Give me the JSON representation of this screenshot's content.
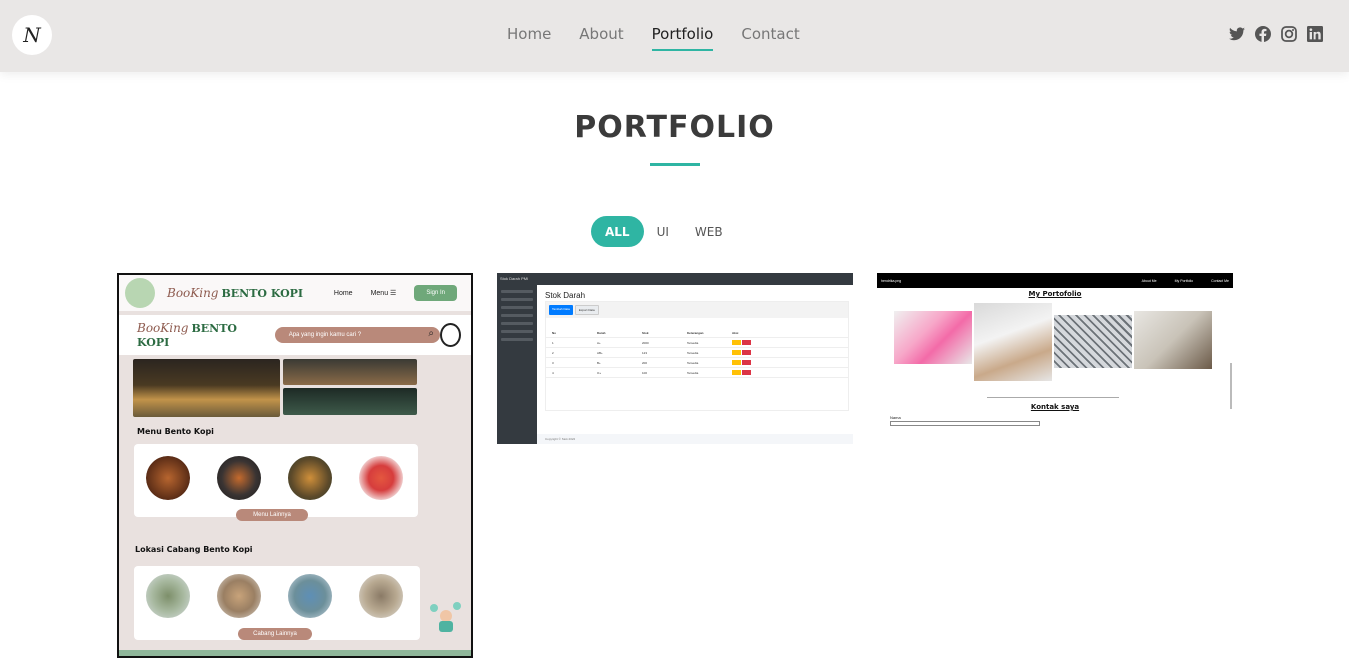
{
  "logo": {
    "text": "N"
  },
  "nav": {
    "items": [
      {
        "label": "Home",
        "active": false
      },
      {
        "label": "About",
        "active": false
      },
      {
        "label": "Portfolio",
        "active": true
      },
      {
        "label": "Contact",
        "active": false
      }
    ]
  },
  "social": [
    "twitter-icon",
    "facebook-icon",
    "instagram-icon",
    "linkedin-icon"
  ],
  "section": {
    "title": "PORTFOLIO"
  },
  "filters": [
    {
      "label": "ALL",
      "active": true
    },
    {
      "label": "UI",
      "active": false
    },
    {
      "label": "WEB",
      "active": false
    }
  ],
  "colors": {
    "accent": "#2fb5a3",
    "header_bg": "#e9e7e6",
    "title": "#3b3b3b"
  },
  "cards": {
    "bento": {
      "brand_script": "BooKing",
      "brand_name": "BENTO KOPI",
      "nav_home": "Home",
      "nav_menu": "Menu ☰",
      "signin": "Sign In",
      "search_placeholder": "Apa yang ingin kamu cari ?",
      "menu_heading": "Menu Bento Kopi",
      "menu_more": "Menu Lainnya",
      "branch_heading": "Lokasi Cabang Bento Kopi",
      "branch_more": "Cabang Lainnya"
    },
    "admin": {
      "app_name": "Stok Darah PMI",
      "page_title": "Stok Darah",
      "btn_add": "Tambah Data",
      "btn_export": "Export Data",
      "columns": [
        "No",
        "Darah",
        "Stok",
        "Keterangan",
        "Aksi"
      ],
      "rows": [
        [
          "1",
          "A+",
          "2000",
          "Tersedia"
        ],
        [
          "2",
          "AB+",
          "123",
          "Tersedia"
        ],
        [
          "3",
          "B+",
          "200",
          "Tersedia"
        ],
        [
          "4",
          "O+",
          "100",
          "Tersedia"
        ]
      ],
      "footer": "Copyright © Stok 2022"
    },
    "portfolio": {
      "brand": "hendrika.png",
      "links": [
        "About Me",
        "My Portfolio",
        "Contact Me"
      ],
      "heading": "My Portofolio",
      "contact_heading": "Kontak saya",
      "field_label": "Nama"
    }
  }
}
